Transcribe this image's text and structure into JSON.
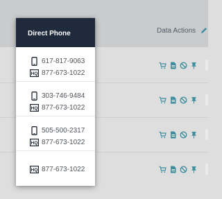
{
  "table": {
    "actions_header": "Data Actions",
    "phone_header": "Direct Phone"
  },
  "rows": [
    {
      "mobile": "617-817-9063",
      "hq": "877-673-1022"
    },
    {
      "mobile": "303-746-9484",
      "hq": "877-673-1022"
    },
    {
      "mobile": "505-500-2317",
      "hq": "877-673-1022"
    },
    {
      "mobile": null,
      "hq": "877-673-1022"
    }
  ],
  "icons": {
    "mobile": "mobile-phone-icon",
    "hq": "hq-phone-icon",
    "actions": [
      "add-to-cart-icon",
      "document-icon",
      "block-icon",
      "pin-icon"
    ],
    "header_edit": "pencil-icon"
  },
  "colors": {
    "header_bg": "#1f2a3c",
    "accent": "#3f8ea0"
  }
}
